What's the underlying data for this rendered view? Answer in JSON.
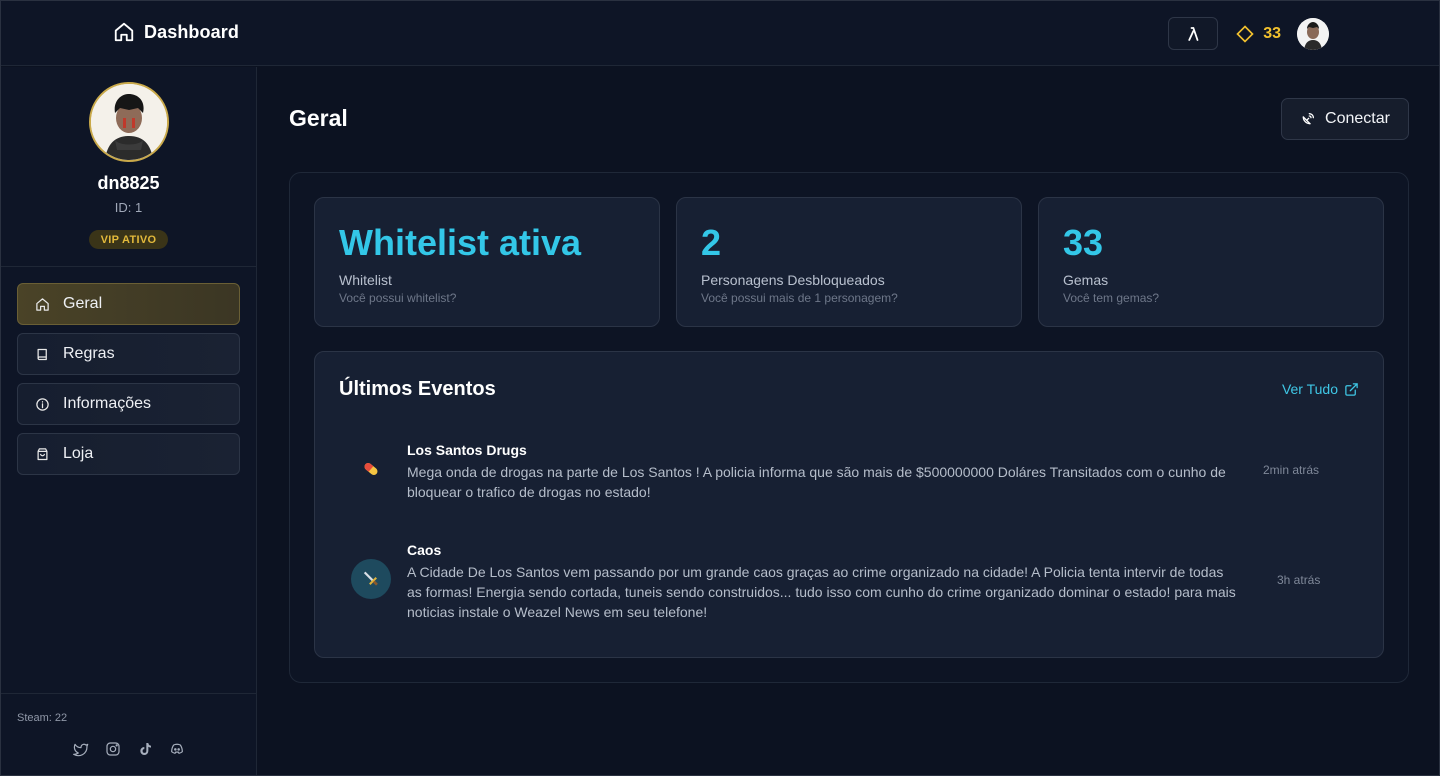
{
  "header": {
    "brand_label": "Dashboard",
    "gems_count": "33"
  },
  "sidebar": {
    "username": "dn8825",
    "user_id": "ID: 1",
    "vip_badge": "VIP ATIVO",
    "nav": [
      {
        "label": "Geral",
        "icon": "home-icon",
        "active": true
      },
      {
        "label": "Regras",
        "icon": "book-icon",
        "active": false
      },
      {
        "label": "Informações",
        "icon": "info-icon",
        "active": false
      },
      {
        "label": "Loja",
        "icon": "shopping-bag-icon",
        "active": false
      }
    ],
    "steam": "Steam: 22",
    "socials": [
      "twitter-icon",
      "instagram-icon",
      "tiktok-icon",
      "discord-icon"
    ]
  },
  "main": {
    "page_title": "Geral",
    "connect_label": "Conectar",
    "stats": [
      {
        "value": "Whitelist ativa",
        "label": "Whitelist",
        "desc": "Você possui whitelist?"
      },
      {
        "value": "2",
        "label": "Personagens Desbloqueados",
        "desc": "Você possui mais de 1 personagem?"
      },
      {
        "value": "33",
        "label": "Gemas",
        "desc": "Você tem gemas?"
      }
    ],
    "events": {
      "title": "Últimos Eventos",
      "see_all": "Ver Tudo",
      "items": [
        {
          "title": "Los Santos Drugs",
          "text": "Mega onda de drogas na parte de Los Santos ! A policia informa que são mais de $500000000 Doláres Transitados com o cunho de bloquear o trafico de drogas no estado!",
          "time": "2min atrás",
          "icon": "pill-icon"
        },
        {
          "title": "Caos",
          "text": "A Cidade De Los Santos vem passando por um grande caos graças ao crime organizado na cidade! A Policia tenta intervir de todas as formas! Energia sendo cortada, tuneis sendo construidos... tudo isso com cunho do crime organizado dominar o estado! para mais noticias instale o Weazel News em seu telefone!",
          "time": "3h atrás",
          "icon": "dagger-icon"
        }
      ]
    }
  },
  "colors": {
    "accent": "#33c7e8",
    "gold": "#f2c12e",
    "background": "#0c1221"
  }
}
